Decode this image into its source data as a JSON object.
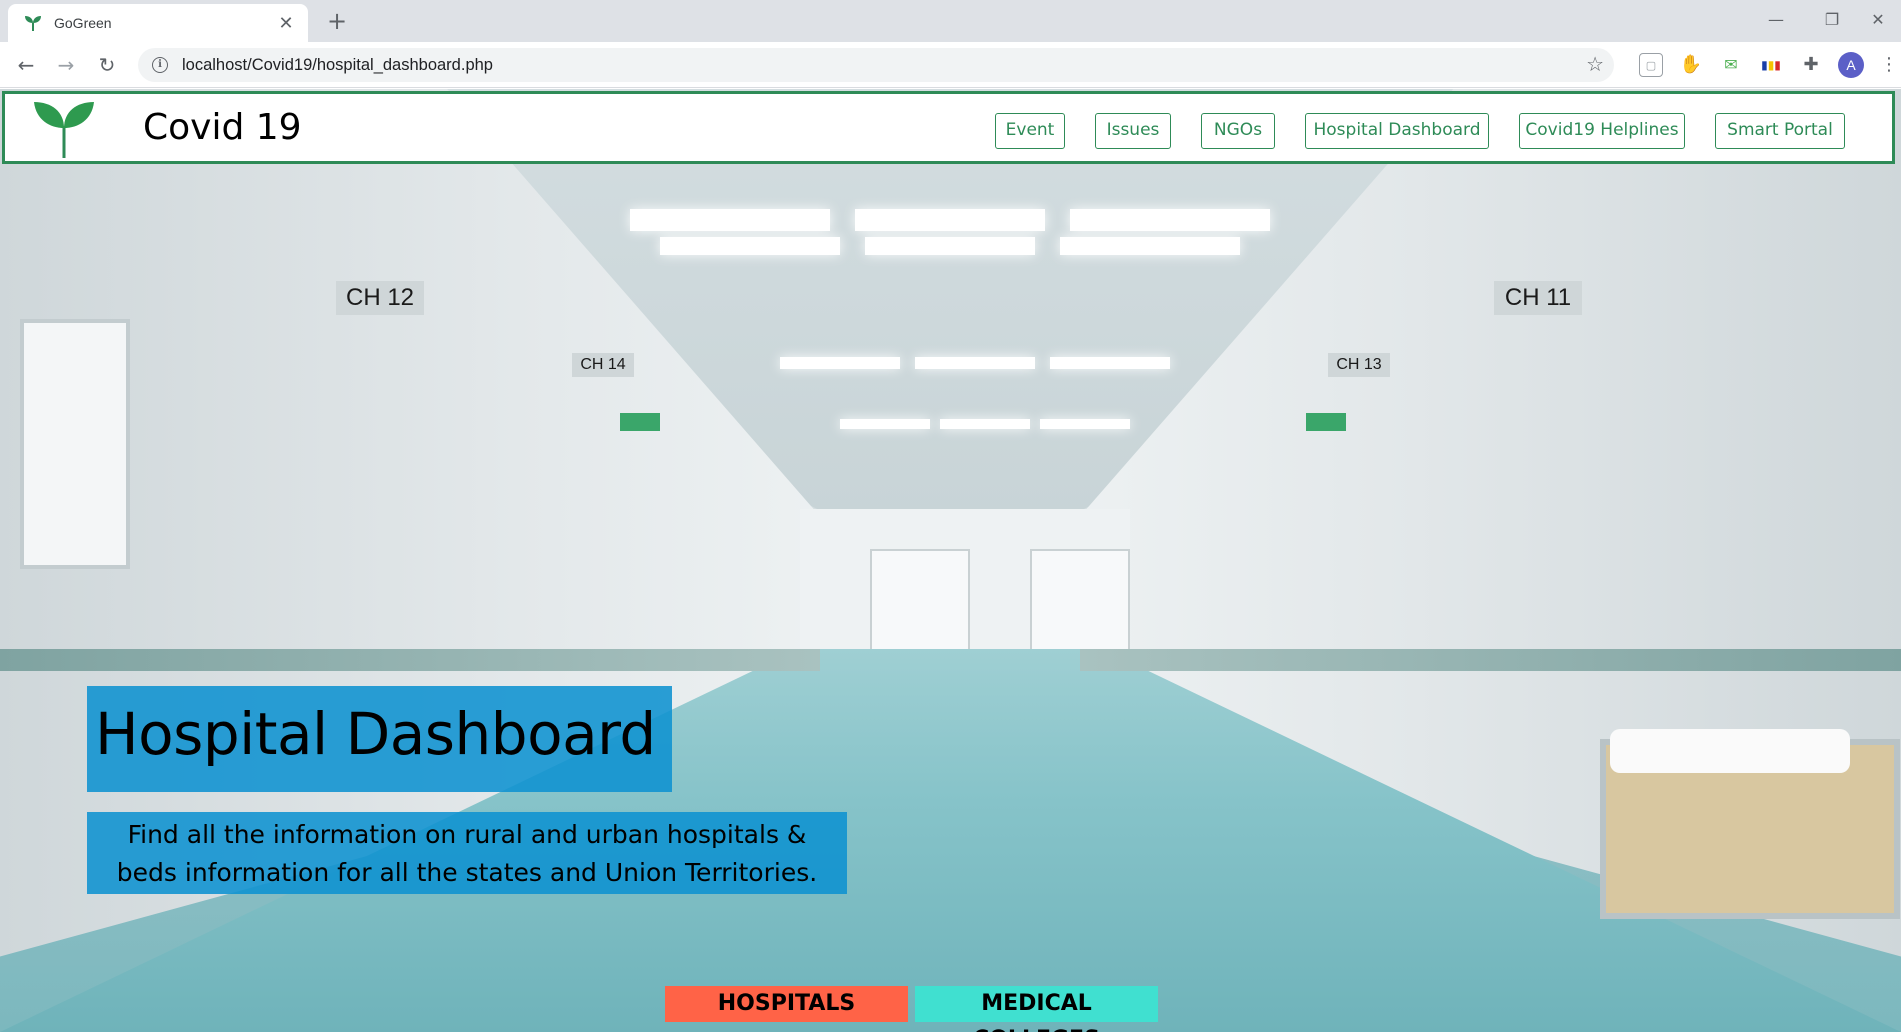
{
  "browser": {
    "tab_title": "GoGreen",
    "url": "localhost/Covid19/hospital_dashboard.php",
    "profile_initial": "A"
  },
  "header": {
    "brand": "Covid 19",
    "nav": [
      "Event",
      "Issues",
      "NGOs",
      "Hospital Dashboard",
      "Covid19 Helplines",
      "Smart Portal"
    ]
  },
  "hero": {
    "title": "Hospital Dashboard",
    "description_line1": "Find all the information on rural and urban hospitals &",
    "description_line2": "beds information for all the states and Union Territories.",
    "signs": [
      "CH 12",
      "CH 14",
      "CH 11",
      "CH 13"
    ]
  },
  "buttons": {
    "hospitals": "HOSPITALS",
    "medical_colleges": "MEDICAL COLLEGES"
  },
  "colors": {
    "brand_green": "#2e8b57",
    "title_box": "#0e92d0",
    "hospitals_button": "#ff6347",
    "colleges_button": "#40e0d0"
  }
}
